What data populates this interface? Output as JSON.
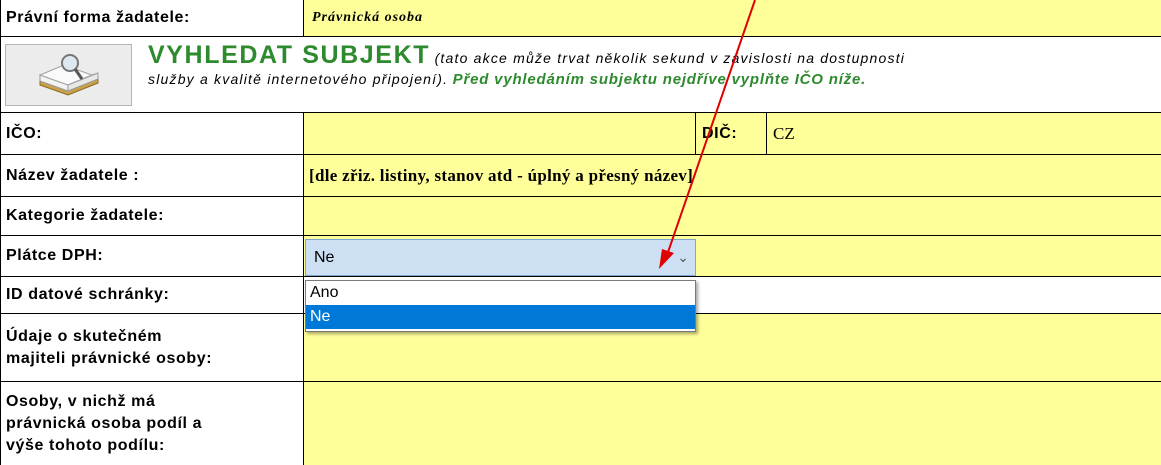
{
  "header": {
    "legal_form_label": "Právní forma žadatele:",
    "legal_form_value": "Právnická osoba"
  },
  "search": {
    "icon": "book-search-icon",
    "title": "VYHLEDAT SUBJEKT",
    "note_part1": "(tato akce může trvat několik sekund v závislosti na dostupnosti",
    "note_part2": "služby a kvalitě internetového připojení).",
    "warning": "Před vyhledáním subjektu nejdříve vyplňte IČO níže."
  },
  "fields": {
    "ico_label": "IČO:",
    "ico_value": "",
    "dic_label": "DIČ:",
    "dic_value": "CZ",
    "name_label": "Název žadatele :",
    "name_value": "[dle zřiz. listiny, stanov atd - úplný a přesný název]",
    "category_label": "Kategorie žadatele:",
    "category_value": "",
    "vat_label": "Plátce DPH:",
    "databox_label": "ID datové schránky:",
    "owner_label_1": "Údaje o skutečném",
    "owner_label_2": "majiteli právnické osoby:",
    "stakes_label_1": "Osoby, v nichž má",
    "stakes_label_2": "právnická osoba podíl a",
    "stakes_label_3": "výše tohoto podílu:"
  },
  "dropdown": {
    "selected": "Ne",
    "options": [
      "Ano",
      "Ne"
    ]
  },
  "colors": {
    "field_bg": "#ffff99",
    "green_text": "#2d8a2d",
    "annotation_arrow": "#e00000",
    "dropdown_highlight": "#0078d7"
  }
}
